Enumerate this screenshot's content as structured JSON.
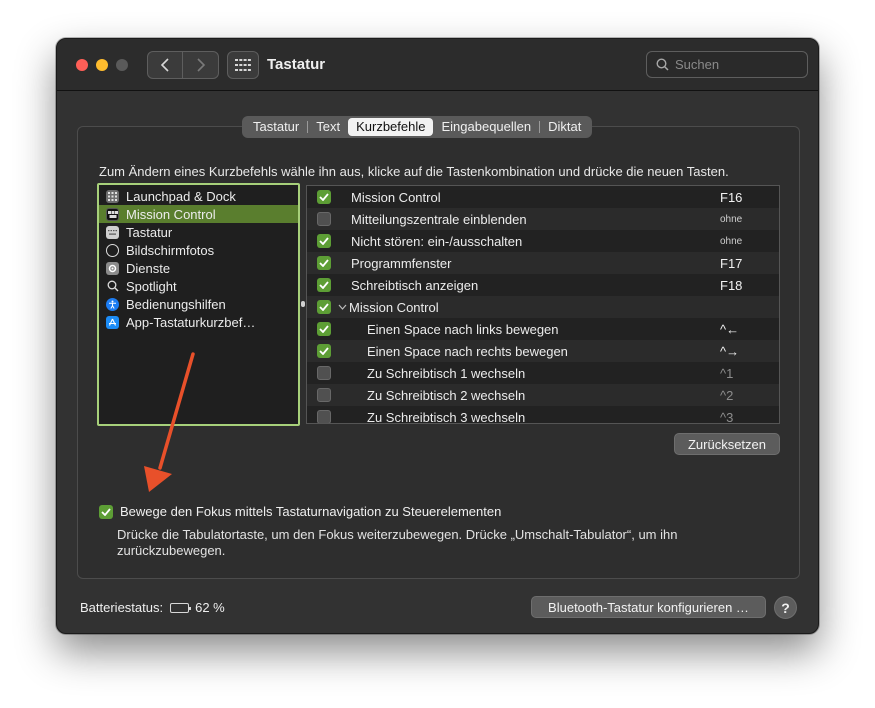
{
  "window": {
    "title": "Tastatur",
    "search": {
      "placeholder": "Suchen"
    }
  },
  "tabs": [
    {
      "label": "Tastatur",
      "active": false
    },
    {
      "label": "Text",
      "active": false
    },
    {
      "label": "Kurzbefehle",
      "active": true
    },
    {
      "label": "Eingabequellen",
      "active": false
    },
    {
      "label": "Diktat",
      "active": false
    }
  ],
  "instruction": "Zum Ändern eines Kurzbefehls wähle ihn aus, klicke auf die Tastenkombination und drücke die neuen Tasten.",
  "categories": [
    {
      "label": "Launchpad & Dock",
      "icon": "launchpad-icon",
      "selected": false
    },
    {
      "label": "Mission Control",
      "icon": "mission-control-icon",
      "selected": true
    },
    {
      "label": "Tastatur",
      "icon": "keyboard-icon",
      "selected": false
    },
    {
      "label": "Bildschirmfotos",
      "icon": "screenshot-icon",
      "selected": false
    },
    {
      "label": "Dienste",
      "icon": "services-gear-icon",
      "selected": false
    },
    {
      "label": "Spotlight",
      "icon": "spotlight-magnifier-icon",
      "selected": false
    },
    {
      "label": "Bedienungshilfen",
      "icon": "accessibility-icon",
      "selected": false
    },
    {
      "label": "App-Tastaturkurzbef…",
      "icon": "app-store-icon",
      "selected": false
    }
  ],
  "shortcuts": [
    {
      "label": "Mission Control",
      "key": "F16",
      "checked": true,
      "indent": false,
      "group": false
    },
    {
      "label": "Mitteilungszentrale einblenden",
      "key": "ohne",
      "checked": false,
      "indent": false,
      "group": false
    },
    {
      "label": "Nicht stören: ein-/ausschalten",
      "key": "ohne",
      "checked": true,
      "indent": false,
      "group": false
    },
    {
      "label": "Programmfenster",
      "key": "F17",
      "checked": true,
      "indent": false,
      "group": false
    },
    {
      "label": "Schreibtisch anzeigen",
      "key": "F18",
      "checked": true,
      "indent": false,
      "group": false
    },
    {
      "label": "Mission Control",
      "key": "",
      "checked": true,
      "indent": false,
      "group": true
    },
    {
      "label": "Einen Space nach links bewegen",
      "key": "^←",
      "checked": true,
      "indent": true,
      "group": false
    },
    {
      "label": "Einen Space nach rechts bewegen",
      "key": "^→",
      "checked": true,
      "indent": true,
      "group": false
    },
    {
      "label": "Zu Schreibtisch 1 wechseln",
      "key": "^1",
      "checked": false,
      "indent": true,
      "group": false
    },
    {
      "label": "Zu Schreibtisch 2 wechseln",
      "key": "^2",
      "checked": false,
      "indent": true,
      "group": false
    },
    {
      "label": "Zu Schreibtisch 3 wechseln",
      "key": "^3",
      "checked": false,
      "indent": true,
      "group": false
    }
  ],
  "reset_button": "Zurücksetzen",
  "focus": {
    "checked": true,
    "label": "Bewege den Fokus mittels Tastaturnavigation zu Steuerelementen",
    "description": "Drücke die Tabulatortaste, um den Fokus weiterzubewegen. Drücke „Umschalt-Tabulator“, um ihn zurückzubewegen."
  },
  "battery": {
    "label": "Batteriestatus:",
    "percent_text": "62 %",
    "level": 0.62
  },
  "bluetooth_button": "Bluetooth-Tastatur konfigurieren …",
  "help_button": "?",
  "colors": {
    "accent_green": "#5d9e35",
    "selection": "#5a7e2e",
    "focus_ring": "#a7d07a",
    "annotation_arrow": "#e8502a"
  }
}
